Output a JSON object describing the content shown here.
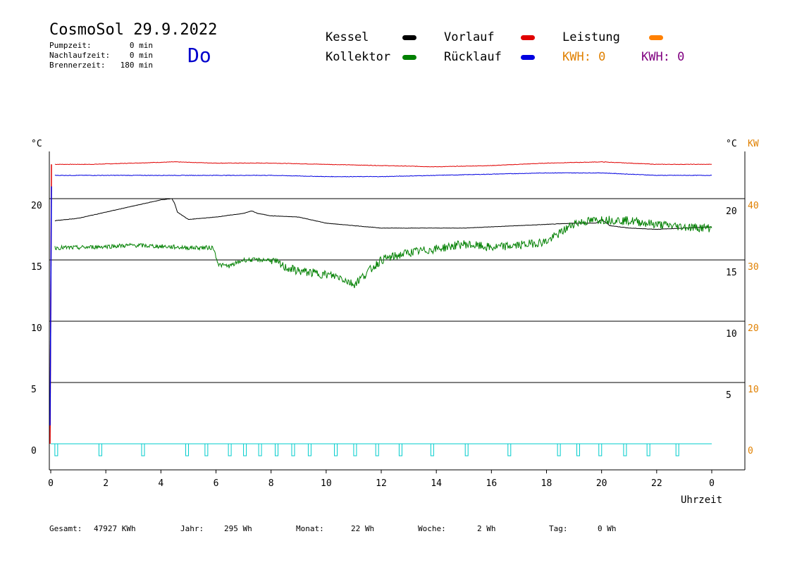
{
  "header": {
    "title": "CosmoSol 29.9.2022",
    "day": "Do",
    "pump_label": "Pumpzeit:",
    "pump_value": "0 min",
    "afterrun_label": "Nachlaufzeit:",
    "afterrun_value": "0 min",
    "burner_label": "Brennerzeit:",
    "burner_value": "180 min"
  },
  "legend": {
    "kessel": "Kessel",
    "kollektor": "Kollektor",
    "vorlauf": "Vorlauf",
    "ruecklauf": "Rücklauf",
    "leistung": "Leistung",
    "kwh_orange": "KWH: 0",
    "kwh_purple": "KWH: 0"
  },
  "colors": {
    "kessel": "#000000",
    "kollektor": "#008000",
    "vorlauf": "#e00000",
    "ruecklauf": "#0000e0",
    "leistung": "#ff8000",
    "kwh_purple": "#800080",
    "pump": "#00cccc",
    "kw_axis": "#e08000"
  },
  "axis_labels": {
    "left_unit": "°C",
    "right_unit": "°C",
    "kw_unit": "KW",
    "x_label": "Uhrzeit"
  },
  "footer": {
    "gesamt_label": "Gesamt:",
    "gesamt_value": "47927 KWh",
    "jahr_label": "Jahr:",
    "jahr_value": "295 Wh",
    "monat_label": "Monat:",
    "monat_value": "22 Wh",
    "woche_label": "Woche:",
    "woche_value": "2 Wh",
    "tag_label": "Tag:",
    "tag_value": "0 Wh"
  },
  "chart_data": {
    "type": "line",
    "xlabel": "Uhrzeit",
    "ylabel": "°C",
    "xlim": [
      0,
      24
    ],
    "ylim": [
      -2,
      24
    ],
    "grid": true,
    "x_ticks": [
      0,
      2,
      4,
      6,
      8,
      10,
      12,
      14,
      16,
      18,
      20,
      22,
      24
    ],
    "x_tick_labels": [
      "0",
      "2",
      "4",
      "6",
      "8",
      "10",
      "12",
      "14",
      "16",
      "18",
      "20",
      "22",
      "0"
    ],
    "y_left_ticks": [
      0,
      5,
      10,
      15,
      20
    ],
    "y_right_ticks": [
      5,
      10,
      15,
      20
    ],
    "kw_ticks": [
      0,
      10,
      20,
      30,
      40
    ],
    "series": [
      {
        "name": "Vorlauf",
        "color": "#e00000",
        "x": [
          0.15,
          1.5,
          3,
          4.5,
          6,
          8,
          10,
          12,
          14,
          16,
          18,
          20,
          22,
          24
        ],
        "y": [
          22.8,
          22.8,
          22.9,
          23.0,
          22.9,
          22.9,
          22.8,
          22.7,
          22.6,
          22.7,
          22.9,
          23.0,
          22.8,
          22.8
        ]
      },
      {
        "name": "Rücklauf",
        "color": "#0000e0",
        "x": [
          0.15,
          2,
          4,
          6,
          8,
          10,
          12,
          14,
          16,
          18,
          20,
          22,
          24
        ],
        "y": [
          21.9,
          21.9,
          21.9,
          21.9,
          21.9,
          21.8,
          21.8,
          21.9,
          22.0,
          22.1,
          22.1,
          21.9,
          21.9
        ]
      },
      {
        "name": "Kessel",
        "color": "#000000",
        "x": [
          0.15,
          1,
          2,
          3,
          4,
          4.4,
          4.5,
          4.6,
          5,
          6,
          7,
          7.3,
          7.5,
          8,
          9,
          10,
          11,
          12,
          13,
          14,
          15,
          16,
          17,
          18,
          19,
          19.8,
          20,
          20.3,
          21,
          22,
          23,
          24
        ],
        "y": [
          18.2,
          18.4,
          18.9,
          19.4,
          19.9,
          20.0,
          19.6,
          18.9,
          18.3,
          18.5,
          18.8,
          19.0,
          18.8,
          18.6,
          18.5,
          18.0,
          17.8,
          17.6,
          17.6,
          17.6,
          17.6,
          17.7,
          17.8,
          17.9,
          18.0,
          18.0,
          18.3,
          17.8,
          17.6,
          17.5,
          17.6,
          17.7
        ]
      },
      {
        "name": "Kollektor",
        "color": "#008000",
        "x": [
          0.15,
          1,
          2,
          3,
          4,
          5,
          5.9,
          6.1,
          6.5,
          7,
          8,
          8.5,
          9,
          10,
          10.5,
          11,
          11.5,
          12,
          12.5,
          13,
          14,
          15,
          16,
          17,
          18,
          18.5,
          19,
          20,
          21,
          22,
          23,
          24
        ],
        "y": [
          16.0,
          16.0,
          16.1,
          16.2,
          16.1,
          16.0,
          16.0,
          14.6,
          14.5,
          15.0,
          15.0,
          14.4,
          14.1,
          13.8,
          13.6,
          13.0,
          14.0,
          15.0,
          15.3,
          15.6,
          15.9,
          16.3,
          16.0,
          16.2,
          16.5,
          17.2,
          18.0,
          18.3,
          18.2,
          17.9,
          17.7,
          17.6
        ]
      },
      {
        "name": "Leistung",
        "color": "#ff8000",
        "x": [
          0,
          24
        ],
        "y": [
          0,
          0
        ]
      }
    ],
    "pump_pulses_h": [
      0.15,
      1.75,
      3.3,
      4.9,
      5.6,
      6.45,
      7.0,
      7.55,
      8.15,
      8.75,
      9.35,
      10.3,
      11.0,
      11.8,
      12.65,
      13.8,
      15.05,
      16.6,
      18.4,
      19.1,
      19.9,
      20.8,
      21.65,
      22.7
    ]
  }
}
